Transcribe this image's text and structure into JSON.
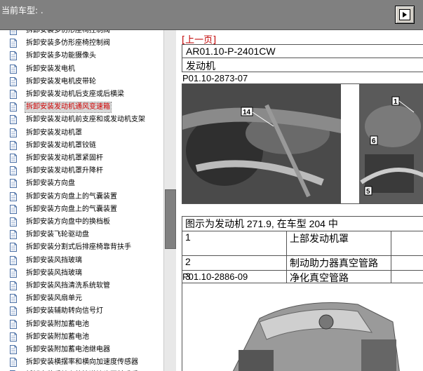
{
  "topbar": {
    "car_label": "当前车型: .",
    "button_icon": "nav-toggle-icon"
  },
  "tree": {
    "items": [
      {
        "label": "拆卸安装多仿形座椅控制阀",
        "selected": false
      },
      {
        "label": "拆卸安装多仿形座椅控制阀",
        "selected": false
      },
      {
        "label": "拆卸安装多功能摄像头",
        "selected": false
      },
      {
        "label": "拆卸安装发电机",
        "selected": false
      },
      {
        "label": "拆卸安装发电机皮带轮",
        "selected": false
      },
      {
        "label": "拆卸安装发动机后支座或后横梁",
        "selected": false
      },
      {
        "label": "拆卸安装发动机通风变速箱",
        "selected": true
      },
      {
        "label": "拆卸安装发动机前支座和或发动机支架",
        "selected": false
      },
      {
        "label": "拆卸安装发动机罩",
        "selected": false
      },
      {
        "label": "拆卸安装发动机罩铰链",
        "selected": false
      },
      {
        "label": "拆卸安装发动机罩紧固杆",
        "selected": false
      },
      {
        "label": "拆卸安装发动机罩升降杆",
        "selected": false
      },
      {
        "label": "拆卸安装方向盘",
        "selected": false
      },
      {
        "label": "拆卸安装方向盘上的气囊装置",
        "selected": false
      },
      {
        "label": "拆卸安装方向盘上的气囊装置",
        "selected": false
      },
      {
        "label": "拆卸安装方向盘中的换档板",
        "selected": false
      },
      {
        "label": "拆卸安装飞轮驱动盘",
        "selected": false
      },
      {
        "label": "拆卸安装分割式后排座椅靠背扶手",
        "selected": false
      },
      {
        "label": "拆卸安装风挡玻璃",
        "selected": false
      },
      {
        "label": "拆卸安装风挡玻璃",
        "selected": false
      },
      {
        "label": "拆卸安装风挡清洗系统软管",
        "selected": false
      },
      {
        "label": "拆卸安装风扇单元",
        "selected": false
      },
      {
        "label": "拆卸安装辅助转向信号灯",
        "selected": false
      },
      {
        "label": "拆卸安装附加蓄电池",
        "selected": false
      },
      {
        "label": "拆卸安装附加蓄电池",
        "selected": false
      },
      {
        "label": "拆卸安装附加蓄电池继电器",
        "selected": false
      },
      {
        "label": "拆卸安装横摆率和横向加速度传感器",
        "selected": false
      },
      {
        "label": "拆卸安装后轴上的管道接头至前或后",
        "selected": false
      }
    ]
  },
  "content": {
    "prev_link": "[上一页]",
    "doc_code": "AR01.10-P-2401CW",
    "section": "发动机",
    "figure1_label": "P01.10-2873-07",
    "figure1_callouts": [
      "14",
      "1",
      "6",
      "5"
    ],
    "caption": "图示为发动机 271.9, 在车型 204 中",
    "legend": [
      {
        "num": "1",
        "desc": "上部发动机罩"
      },
      {
        "num": "2",
        "desc": "制动助力器真空管路"
      },
      {
        "num": "3",
        "desc": "净化真空管路"
      }
    ],
    "figure2_label": "P01.10-2886-09"
  }
}
